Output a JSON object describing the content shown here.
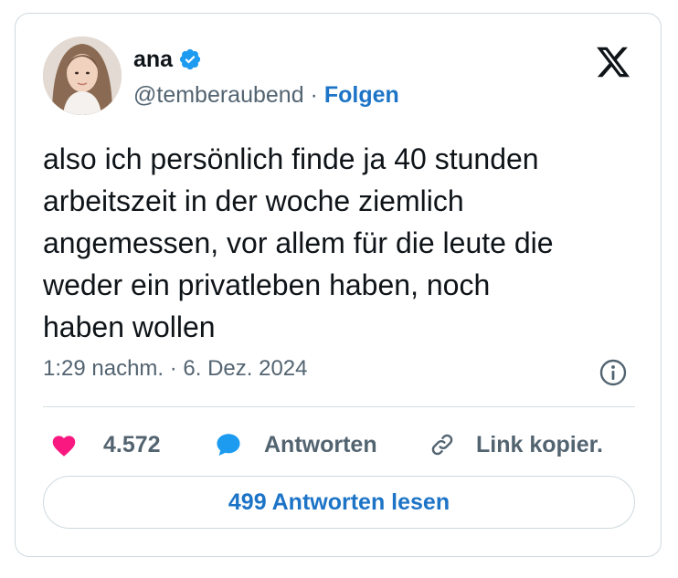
{
  "author": {
    "name": "ana",
    "handle": "@temberaubend",
    "separator": " · ",
    "follow_label": "Folgen",
    "verified": true
  },
  "tweet": {
    "lines": [
      "also ich persönlich finde ja 40 stunden",
      "arbeitszeit in der woche ziemlich",
      "angemessen, vor allem für die leute die",
      "weder ein privatleben haben, noch",
      "haben wollen"
    ],
    "timestamp": "1:29 nachm. · 6. Dez. 2024"
  },
  "actions": {
    "like_count": "4.572",
    "reply_label": "Antworten",
    "copy_label": "Link kopier."
  },
  "read_replies_label": "499 Antworten lesen",
  "colors": {
    "accent": "#1d74c7",
    "like": "#f91880",
    "verified": "#1d9bf0",
    "text": "#0f1419",
    "muted": "#536471"
  },
  "icons": {
    "brand": "x-logo-icon",
    "verified": "verified-badge-icon",
    "info": "info-icon",
    "like": "heart-icon",
    "reply": "speech-bubble-icon",
    "copy": "link-icon"
  }
}
